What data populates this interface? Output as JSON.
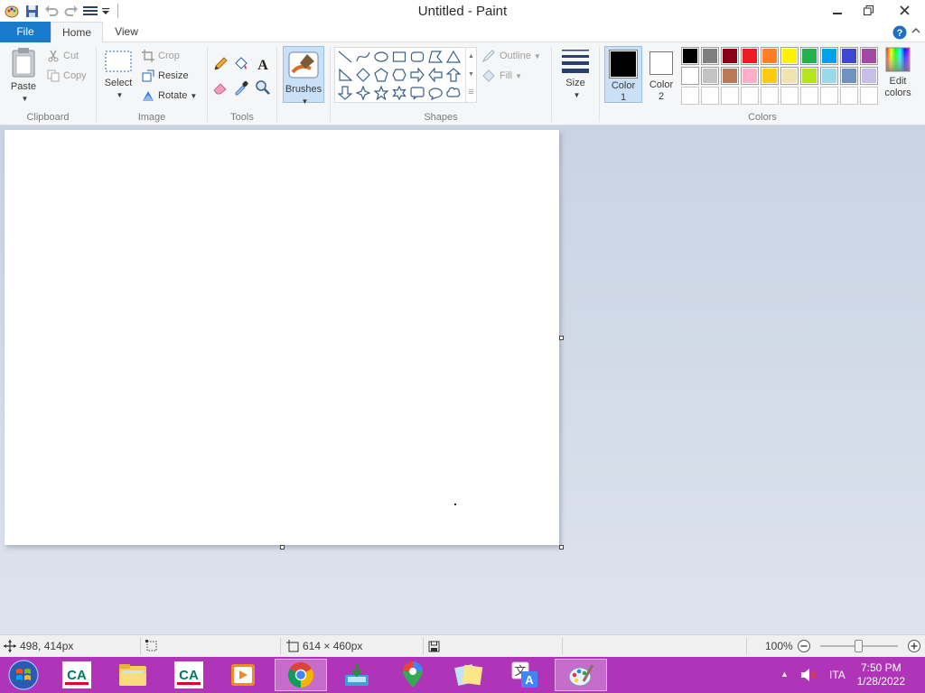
{
  "window": {
    "title": "Untitled - Paint"
  },
  "tabs": {
    "file": "File",
    "home": "Home",
    "view": "View"
  },
  "clipboard": {
    "paste": "Paste",
    "cut": "Cut",
    "copy": "Copy",
    "label": "Clipboard"
  },
  "image": {
    "select": "Select",
    "crop": "Crop",
    "resize": "Resize",
    "rotate": "Rotate",
    "label": "Image"
  },
  "tools": {
    "label": "Tools"
  },
  "brushes": {
    "label": "Brushes"
  },
  "shapes": {
    "outline": "Outline",
    "fill": "Fill",
    "label": "Shapes"
  },
  "size": {
    "label": "Size"
  },
  "colors": {
    "color1_line1": "Color",
    "color1_line2": "1",
    "color2_line1": "Color",
    "color2_line2": "2",
    "edit_line1": "Edit",
    "edit_line2": "colors",
    "label": "Colors",
    "color1_value": "#000000",
    "color2_value": "#ffffff",
    "palette_row1": [
      "#000000",
      "#7f7f7f",
      "#880015",
      "#ed1c24",
      "#ff7f27",
      "#fff200",
      "#22b14c",
      "#00a2e8",
      "#3f48cc",
      "#a349a4"
    ],
    "palette_row2": [
      "#ffffff",
      "#c3c3c3",
      "#b97a57",
      "#ffaec9",
      "#ffc90e",
      "#efe4b0",
      "#b5e61d",
      "#99d9ea",
      "#7092be",
      "#c8bfe7"
    ]
  },
  "status": {
    "cursor_pos": "498, 414px",
    "canvas_size": "614 × 460px",
    "zoom": "100%"
  },
  "tray": {
    "language": "ITA",
    "time": "7:50 PM",
    "date": "1/28/2022"
  }
}
